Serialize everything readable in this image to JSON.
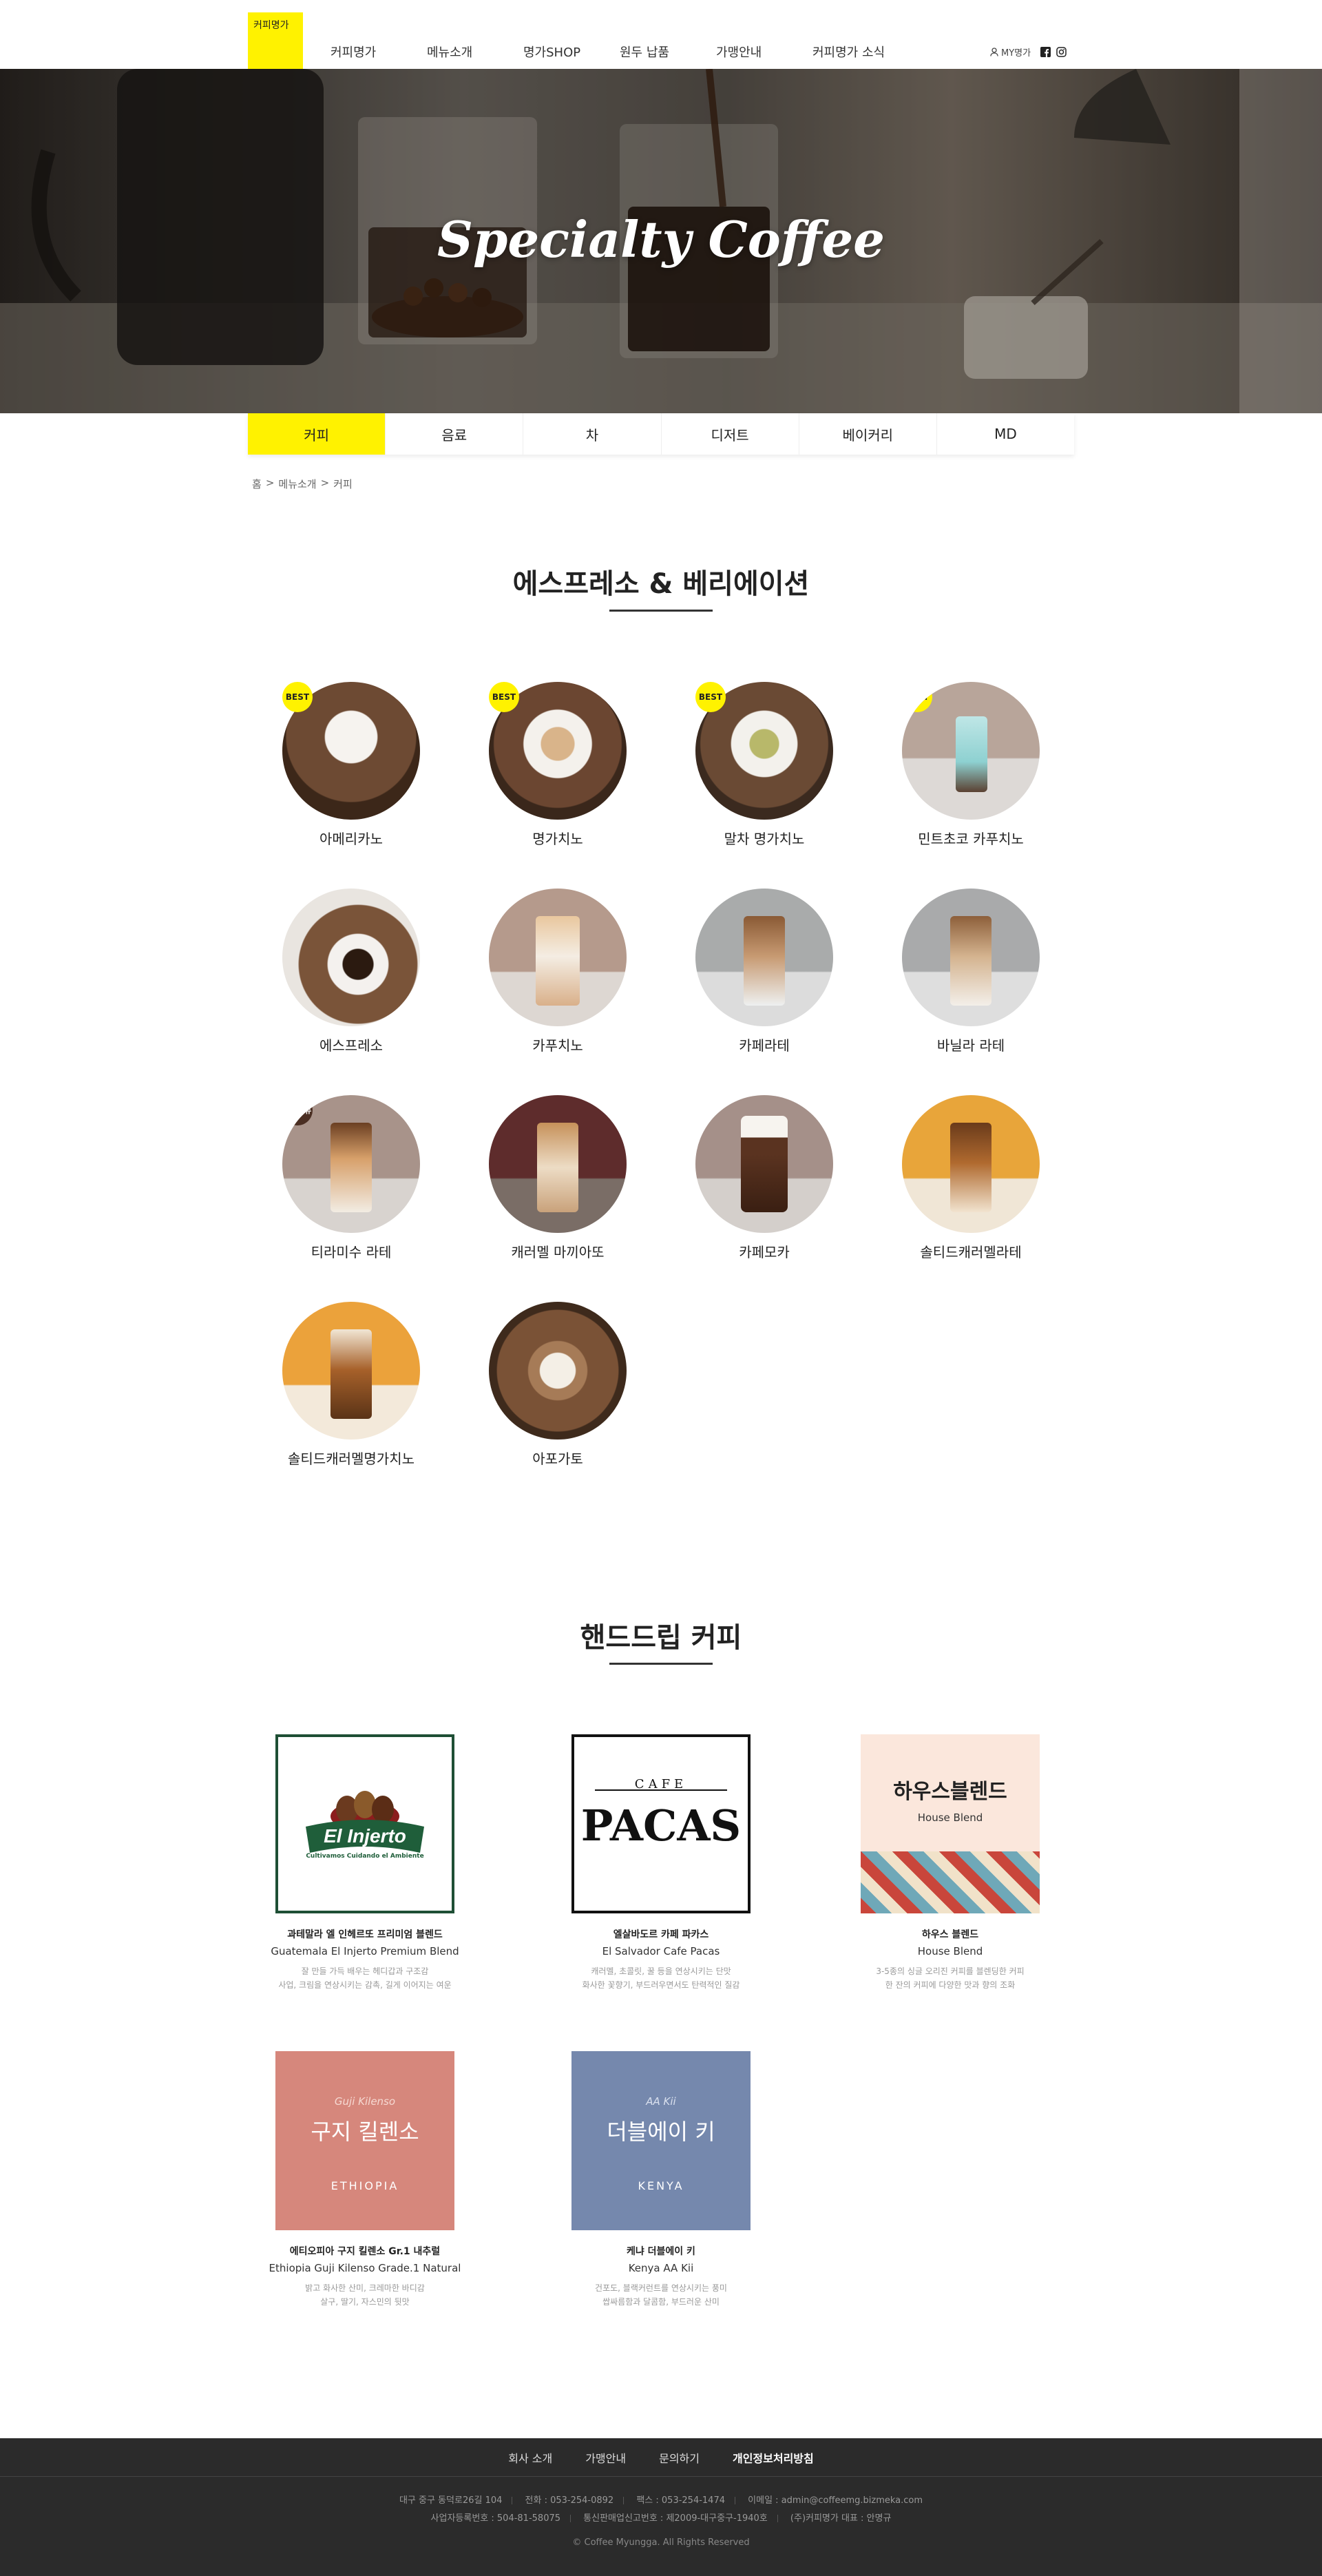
{
  "header": {
    "logo_text": "커피명가",
    "nav": [
      "커피명가",
      "메뉴소개",
      "명가SHOP",
      "원두 납품",
      "가맹안내",
      "커피명가 소식"
    ],
    "util": {
      "my_label": "MY명가",
      "facebook_icon": "facebook-icon",
      "instagram_icon": "instagram-icon"
    }
  },
  "hero": {
    "title": "Specialty Coffee"
  },
  "tabs": [
    {
      "label": "커피",
      "active": true
    },
    {
      "label": "음료",
      "active": false
    },
    {
      "label": "차",
      "active": false
    },
    {
      "label": "디저트",
      "active": false
    },
    {
      "label": "베이커리",
      "active": false
    },
    {
      "label": "MD",
      "active": false
    }
  ],
  "breadcrumb": [
    "홈",
    ">",
    "메뉴소개",
    ">",
    "커피"
  ],
  "espresso": {
    "title": "에스프레소 & 베리에이션",
    "items": [
      {
        "name": "아메리카노",
        "badge": "BEST"
      },
      {
        "name": "명가치노",
        "badge": "BEST"
      },
      {
        "name": "말차 명가치노",
        "badge": "BEST"
      },
      {
        "name": "민트초코 카푸치노",
        "badge": "BEST"
      },
      {
        "name": "에스프레소",
        "badge": ""
      },
      {
        "name": "카푸치노",
        "badge": ""
      },
      {
        "name": "카페라테",
        "badge": ""
      },
      {
        "name": "바닐라 라테",
        "badge": ""
      },
      {
        "name": "티라미수 라테",
        "badge": "시즌메뉴"
      },
      {
        "name": "캐러멜 마끼아또",
        "badge": ""
      },
      {
        "name": "카페모카",
        "badge": ""
      },
      {
        "name": "솔티드캐러멜라테",
        "badge": ""
      },
      {
        "name": "솔티드캐러멜명가치노",
        "badge": ""
      },
      {
        "name": "아포가토",
        "badge": ""
      }
    ]
  },
  "handdrip": {
    "title": "핸드드립 커피",
    "items": [
      {
        "name_ko": "과테말라 엘 인헤르또 프리미엄 블렌드",
        "name_en": "Guatemala El Injerto Premium Blend",
        "desc": [
          "잘 만들 가득 배우는 헤디갑과 구조감",
          "사업, 크림을 연상시키는 감촉, 길게 이어지는 여운"
        ],
        "card_text": "El Injerto",
        "card_sub": "Cultivamos Cuidando el Ambiente"
      },
      {
        "name_ko": "엘살바도르 카페 파카스",
        "name_en": "El Salvador Cafe Pacas",
        "desc": [
          "캐러멜, 초콜릿, 꿀 등을 연상시키는 단맛",
          "화사한 꽃향기, 부드러우면서도 탄력적인 질감"
        ],
        "card_text": "PACAS",
        "card_sub": "CAFE"
      },
      {
        "name_ko": "하우스 블렌드",
        "name_en": "House Blend",
        "desc": [
          "3-5종의 싱글 오리진 커피를 블렌딩한 커피",
          "한 잔의 커피에 다양한 맛과 향의 조화"
        ],
        "card_text": "하우스블렌드",
        "card_sub": "House Blend"
      },
      {
        "name_ko": "에티오피아 구지 킬렌소 Gr.1 내추럴",
        "name_en": "Ethiopia Guji Kilenso Grade.1 Natural",
        "desc": [
          "밝고 화사한 산미, 크레마한 바디감",
          "살구, 딸기, 자스민의 뒷맛"
        ],
        "card_text": "구지 킬렌소",
        "card_sub": "Guji Kilenso",
        "card_foot": "ETHIOPIA"
      },
      {
        "name_ko": "케냐 더블에이 키",
        "name_en": "Kenya AA Kii",
        "desc": [
          "건포도, 블랙커런트를 연상시키는 풍미",
          "쌉싸름함과 달콤함, 부드러운 산미"
        ],
        "card_text": "더블에이 키",
        "card_sub": "AA Kii",
        "card_foot": "KENYA"
      }
    ]
  },
  "footer": {
    "links": [
      "회사 소개",
      "가맹안내",
      "문의하기",
      "개인정보처리방침"
    ],
    "line1": [
      "대구 중구 동덕로26길 104",
      "전화 : 053-254-0892",
      "팩스 : 053-254-1474",
      "이메일 : admin@coffeemg.bizmeka.com"
    ],
    "line2": [
      "사업자등록번호 : 504-81-58075",
      "통신판매업신고번호 : 제2009-대구중구-1940호",
      "(주)커피명가 대표 : 안명규"
    ],
    "copyright": "© Coffee Myungga. All Rights Reserved"
  },
  "colors": {
    "accent": "#fff200",
    "footer_bg": "#2b2b2b",
    "season_badge": "#4a2e22"
  }
}
